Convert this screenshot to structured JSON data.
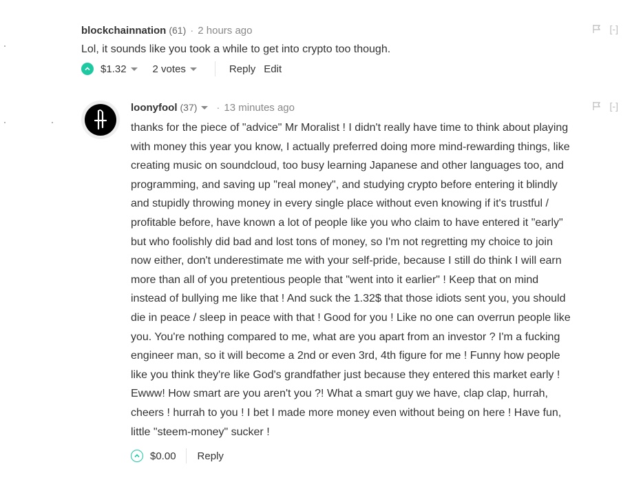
{
  "comments": [
    {
      "author": "blockchainnation",
      "reputation": "(61)",
      "separator": "·",
      "time": "2 hours ago",
      "collapse": "[-]",
      "body": "Lol, it sounds like you took a while to get into crypto too though.",
      "payout": "$1.32",
      "votes": "2 votes",
      "actions": [
        "Reply",
        "Edit"
      ],
      "voted": true
    },
    {
      "author": "loonyfool",
      "reputation": "(37)",
      "separator": "·",
      "time": "13 minutes ago",
      "collapse": "[-]",
      "body_lines": [
        "thanks for the piece of \"advice\" Mr Moralist ! I didn't really have time to think about playing",
        "with money this year you know, I actually preferred doing more mind-rewarding things, like",
        "creating music on soundcloud, too busy learning Japanese and other languages too, and",
        "programming, and saving up \"real money\", and studying crypto before entering it blindly",
        "and stupidly throwing money in every single place without even knowing if it's trustful /",
        "profitable before, have known a lot of people like you who claim to have entered it \"early\"",
        "but who foolishly did bad and lost tons of money, so I'm not regretting my choice to join",
        "now either, don't underestimate me with your self-pride, because I still do think I will earn",
        "more than all of you pretentious people that \"went into it earlier\" ! Keep that on mind",
        "instead of bullying me like that ! And suck the 1.32$ that those idiots sent you, you should",
        "die in peace / sleep in peace with that ! Good for you ! Like no one can overrun people like",
        "you. You're nothing compared to me, what are you apart from an investor ? I'm a fucking",
        "engineer man, so it will become a 2nd or even 3rd, 4th figure for me ! Funny how people",
        "like you think they're like God's grandfather just because they entered this market early !",
        "Ewww! How smart are you aren't you ?! What a smart guy we have, clap clap, hurrah,",
        "cheers ! hurrah to you ! I bet I made more money even without being on here ! Have fun,",
        "little \"steem-money\" sucker !"
      ],
      "payout": "$0.00",
      "actions": [
        "Reply"
      ],
      "voted": false
    }
  ],
  "colors": {
    "accent": "#1ec9a2",
    "text": "#333333",
    "muted": "#888888"
  },
  "icons": {
    "flag": "flag-icon",
    "upvote": "upvote-icon",
    "avatar": "loonyfool-avatar"
  }
}
